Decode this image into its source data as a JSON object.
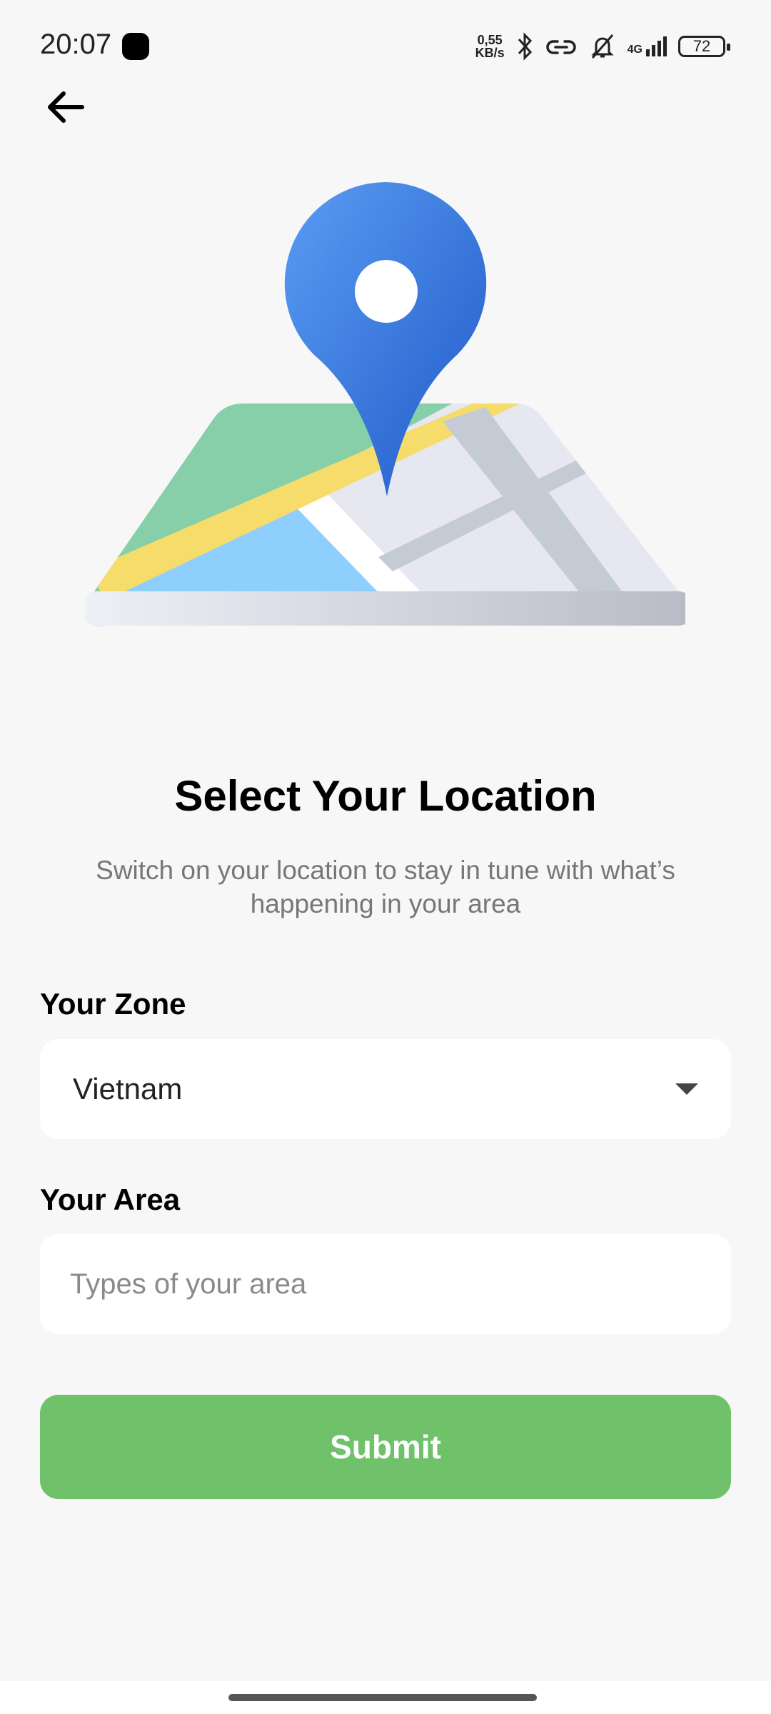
{
  "status_bar": {
    "time": "20:07",
    "net_speed_value": "0,55",
    "net_speed_unit": "KB/s",
    "network_type": "4G",
    "battery": "72",
    "icons": [
      "bluetooth-icon",
      "link-icon",
      "bell-off-icon",
      "signal-icon",
      "battery-icon"
    ]
  },
  "header": {
    "back_icon": "arrow-left-icon"
  },
  "illustration": {
    "name": "map-location-pin",
    "pin_color": "#3a78e0",
    "map_colors": [
      "#86cfa8",
      "#f6dc6a",
      "#8ecffd",
      "#e6e7f0"
    ]
  },
  "main": {
    "title": "Select Your Location",
    "subtitle": "Switch on your location to stay in tune with what’s happening in your area",
    "zone_label": "Your Zone",
    "zone_value": "Vietnam",
    "area_label": "Your Area",
    "area_placeholder": "Types of your area",
    "submit_label": "Submit"
  },
  "colors": {
    "accent": "#6fc16a",
    "background": "#f7f7f7"
  }
}
